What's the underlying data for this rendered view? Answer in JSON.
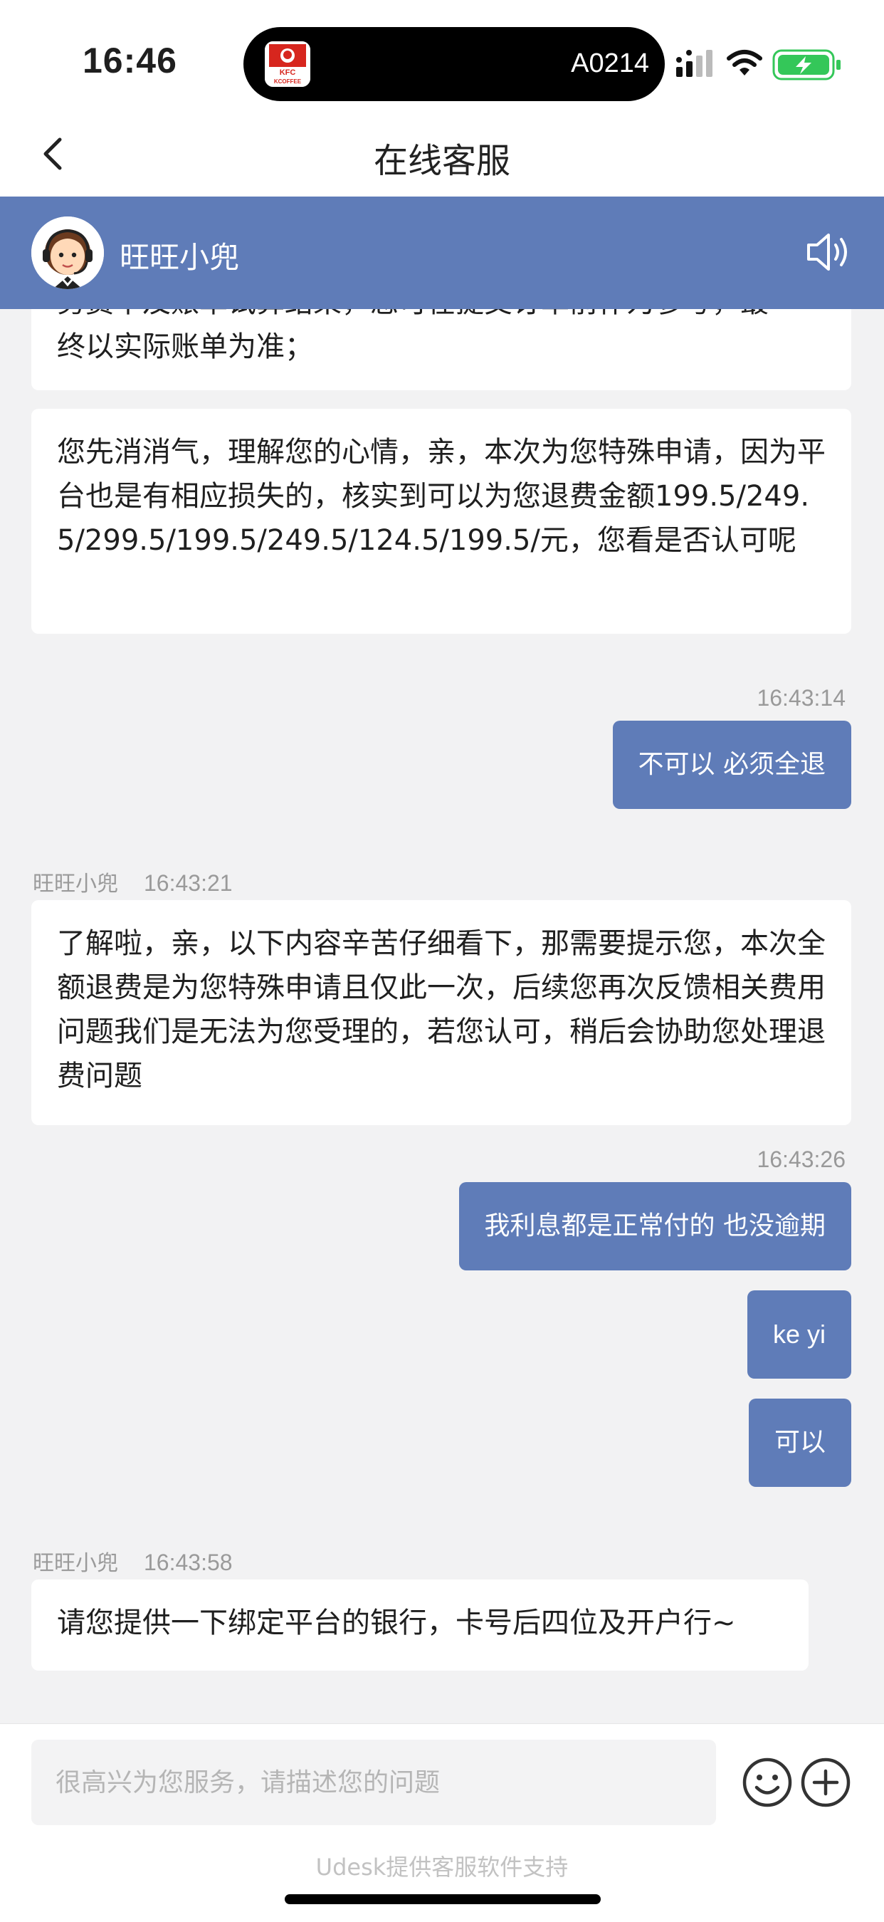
{
  "status_bar": {
    "time": "16:46",
    "island_text": "A0214",
    "app_icon_text_top": "KFC",
    "app_icon_text_bottom": "KCOFFEE"
  },
  "nav": {
    "title": "在线客服"
  },
  "agent": {
    "name": "旺旺小兜"
  },
  "messages": {
    "m0_partial_top": "务费率及账单试算结果，您可在提交订单前作为参考，最",
    "m0_partial_bottom": "终以实际账单为准；",
    "m1_text": "您先消消气，理解您的心情，亲，本次为您特殊申请，因为平台也是有相应损失的，核实到可以为您退费金额199.5/249.5/299.5/199.5/249.5/124.5/199.5/元，您看是否认可呢",
    "m2_time": "16:43:14",
    "m2_text": "不可以 必须全退",
    "m3_sender": "旺旺小兜",
    "m3_time": "16:43:21",
    "m3_text": "了解啦，亲，以下内容辛苦仔细看下，那需要提示您，本次全额退费是为您特殊申请且仅此一次，后续您再次反馈相关费用问题我们是无法为您受理的，若您认可，稍后会协助您处理退费问题",
    "m4_time": "16:43:26",
    "m4_text": "我利息都是正常付的 也没逾期",
    "m5_text": "ke yi",
    "m6_text": "可以",
    "m7_sender": "旺旺小兜",
    "m7_time": "16:43:58",
    "m7_text": "请您提供一下绑定平台的银行，卡号后四位及开户行~"
  },
  "input": {
    "placeholder": "很高兴为您服务，请描述您的问题",
    "value": ""
  },
  "footer": {
    "note": "Udesk提供客服软件支持"
  },
  "colors": {
    "accent": "#5f7cb8",
    "background": "#f2f2f3",
    "battery": "#34c759"
  }
}
